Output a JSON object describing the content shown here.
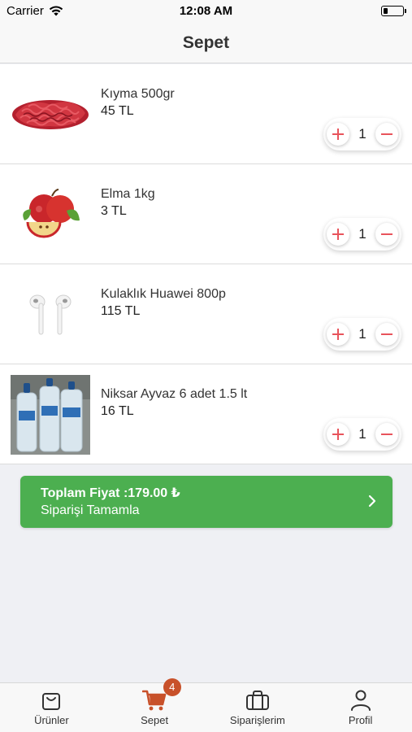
{
  "status_bar": {
    "carrier": "Carrier",
    "time": "12:08 AM"
  },
  "header": {
    "title": "Sepet"
  },
  "cart": {
    "items": [
      {
        "name": "Kıyma 500gr",
        "price": "45 TL",
        "quantity": "1",
        "image": "minced-meat"
      },
      {
        "name": "Elma 1kg",
        "price": "3 TL",
        "quantity": "1",
        "image": "apples"
      },
      {
        "name": "Kulaklık Huawei 800p",
        "price": "115 TL",
        "quantity": "1",
        "image": "earbuds"
      },
      {
        "name": "Niksar Ayvaz 6 adet 1.5 lt",
        "price": "16 TL",
        "quantity": "1",
        "image": "water-bottles"
      }
    ]
  },
  "checkout": {
    "total_line": "Toplam Fiyat :179.00 ₺",
    "action_label": "Siparişi Tamamla"
  },
  "tabs": [
    {
      "label": "Ürünler",
      "icon": "bag-icon",
      "active": false
    },
    {
      "label": "Sepet",
      "icon": "cart-icon",
      "active": true,
      "badge": "4"
    },
    {
      "label": "Siparişlerim",
      "icon": "briefcase-icon",
      "active": false
    },
    {
      "label": "Profil",
      "icon": "person-icon",
      "active": false
    }
  ],
  "colors": {
    "accent": "#4caf50",
    "stepper_red": "#e8545c",
    "cart_icon": "#c8512a"
  }
}
